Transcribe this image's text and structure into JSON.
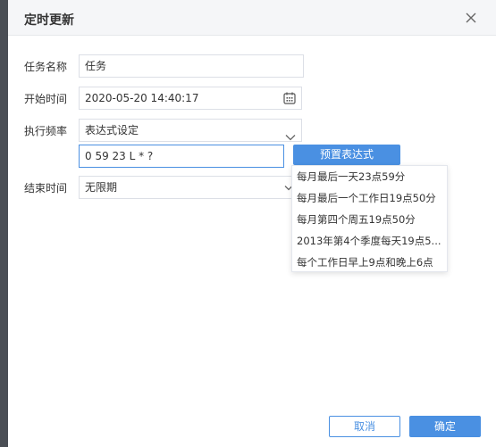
{
  "dialog": {
    "title": "定时更新",
    "close_icon": "close-icon"
  },
  "form": {
    "task_name_label": "任务名称",
    "task_name_value": "任务",
    "start_time_label": "开始时间",
    "start_time_value": "2020-05-20 14:40:17",
    "frequency_label": "执行频率",
    "frequency_value": "表达式设定",
    "expression_value": "0 59 23 L * ?",
    "end_time_label": "结束时间",
    "end_time_value": "无限期"
  },
  "preset": {
    "button_label": "预置表达式",
    "items": [
      "每月最后一天23点59分",
      "每月最后一个工作日19点50分",
      "每月第四个周五19点50分",
      "2013年第4个季度每天19点5...",
      "每个工作日早上9点和晚上6点"
    ]
  },
  "footer": {
    "cancel_label": "取消",
    "ok_label": "确定"
  },
  "colors": {
    "accent": "#4a90e2",
    "header_bg": "#f5f6f8",
    "backdrop": "#5b5f66"
  }
}
